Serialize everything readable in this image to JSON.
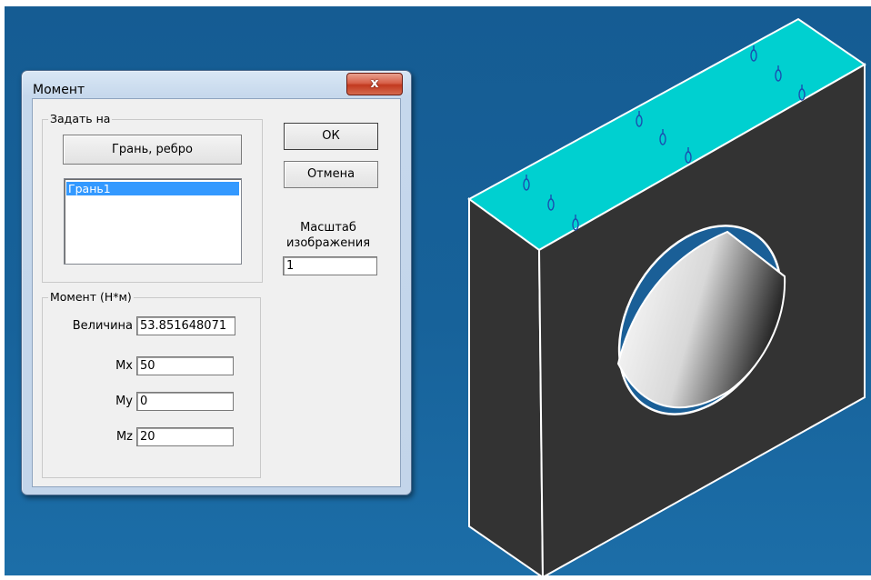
{
  "window": {
    "title": "Момент",
    "close_glyph": "x"
  },
  "apply_group": {
    "label": "Задать на",
    "face_edge_button": "Грань, ребро",
    "list_items": [
      "Грань1"
    ]
  },
  "buttons": {
    "ok": "ОК",
    "cancel": "Отмена"
  },
  "scale": {
    "label_line1": "Масштаб",
    "label_line2": "изображения",
    "value": "1"
  },
  "moment_group": {
    "label": "Момент (Н*м)",
    "magnitude_label": "Величина",
    "magnitude_value": "53.851648071",
    "mx_label": "Mx",
    "mx_value": "50",
    "my_label": "My",
    "my_value": "0",
    "mz_label": "Mz",
    "mz_value": "20"
  },
  "colors": {
    "viewport_bg": "#17629a",
    "selected_face": "#00cccc",
    "part_face": "#333333",
    "selection_highlight": "#3399ff"
  }
}
